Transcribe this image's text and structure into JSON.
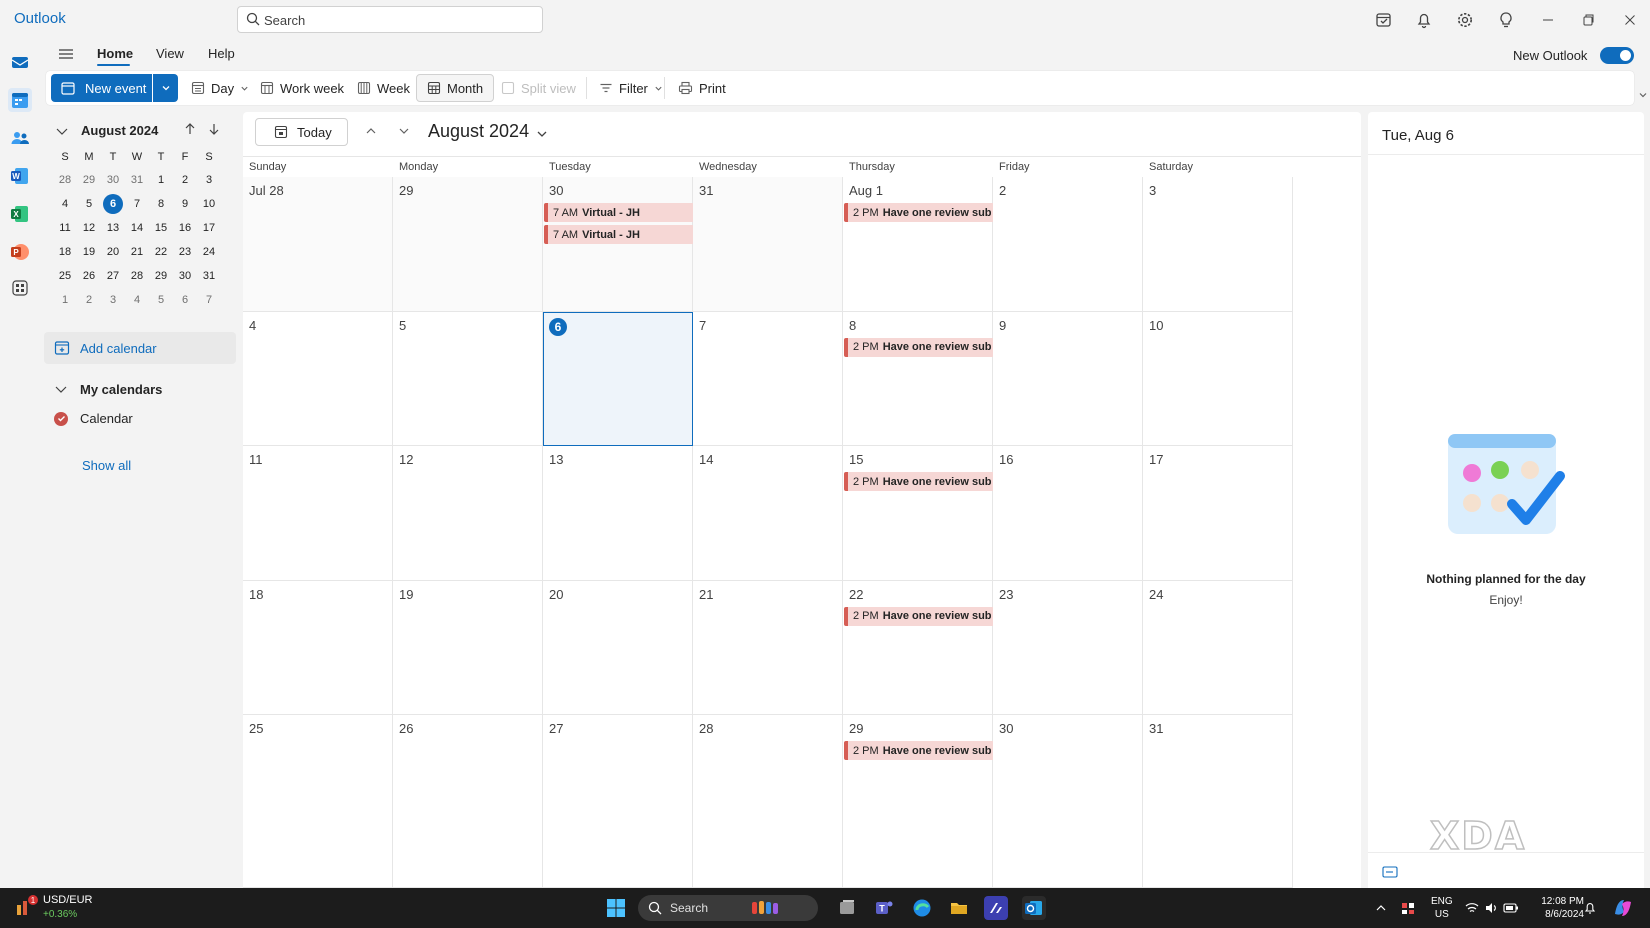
{
  "app": {
    "title": "Outlook"
  },
  "search": {
    "placeholder": "Search"
  },
  "ribbon": {
    "tabs": [
      {
        "label": "Home",
        "active": true
      },
      {
        "label": "View"
      },
      {
        "label": "Help"
      }
    ],
    "new_outlook_label": "New Outlook",
    "new_outlook_enabled": true
  },
  "commands": {
    "new_event": "New event",
    "day": "Day",
    "work_week": "Work week",
    "week": "Week",
    "month": "Month",
    "split_view": "Split view",
    "filter": "Filter",
    "print": "Print"
  },
  "mini_calendar": {
    "title": "August 2024",
    "weekdays": [
      "S",
      "M",
      "T",
      "W",
      "T",
      "F",
      "S"
    ],
    "weeks": [
      [
        "28",
        "29",
        "30",
        "31",
        "1",
        "2",
        "3"
      ],
      [
        "4",
        "5",
        "6",
        "7",
        "8",
        "9",
        "10"
      ],
      [
        "11",
        "12",
        "13",
        "14",
        "15",
        "16",
        "17"
      ],
      [
        "18",
        "19",
        "20",
        "21",
        "22",
        "23",
        "24"
      ],
      [
        "25",
        "26",
        "27",
        "28",
        "29",
        "30",
        "31"
      ],
      [
        "1",
        "2",
        "3",
        "4",
        "5",
        "6",
        "7"
      ]
    ]
  },
  "left_pane": {
    "add_calendar": "Add calendar",
    "my_calendars": "My calendars",
    "calendars": [
      {
        "name": "Calendar",
        "color": "#c8504a"
      }
    ],
    "show_all": "Show all"
  },
  "main": {
    "today_label": "Today",
    "month_title": "August 2024",
    "weekdays": [
      "Sunday",
      "Monday",
      "Tuesday",
      "Wednesday",
      "Thursday",
      "Friday",
      "Saturday"
    ],
    "weeks": [
      [
        {
          "label": "Jul 28",
          "other": true
        },
        {
          "label": "29",
          "other": true
        },
        {
          "label": "30",
          "other": true,
          "events": [
            {
              "time": "7 AM",
              "title": "Virtual - JH"
            },
            {
              "time": "7 AM",
              "title": "Virtual - JH"
            }
          ]
        },
        {
          "label": "31",
          "other": true
        },
        {
          "label": "Aug 1",
          "events": [
            {
              "time": "2 PM",
              "title": "Have one review sub",
              "recurring": true
            }
          ]
        },
        {
          "label": "2"
        },
        {
          "label": "3"
        }
      ],
      [
        {
          "label": "4"
        },
        {
          "label": "5"
        },
        {
          "label": "6",
          "today": true
        },
        {
          "label": "7"
        },
        {
          "label": "8",
          "events": [
            {
              "time": "2 PM",
              "title": "Have one review sub",
              "recurring": true
            }
          ]
        },
        {
          "label": "9"
        },
        {
          "label": "10"
        }
      ],
      [
        {
          "label": "11"
        },
        {
          "label": "12"
        },
        {
          "label": "13"
        },
        {
          "label": "14"
        },
        {
          "label": "15",
          "events": [
            {
              "time": "2 PM",
              "title": "Have one review sub",
              "recurring": true
            }
          ]
        },
        {
          "label": "16"
        },
        {
          "label": "17"
        }
      ],
      [
        {
          "label": "18"
        },
        {
          "label": "19"
        },
        {
          "label": "20"
        },
        {
          "label": "21"
        },
        {
          "label": "22",
          "events": [
            {
              "time": "2 PM",
              "title": "Have one review sub",
              "recurring": true
            }
          ]
        },
        {
          "label": "23"
        },
        {
          "label": "24"
        }
      ],
      [
        {
          "label": "25"
        },
        {
          "label": "26"
        },
        {
          "label": "27"
        },
        {
          "label": "28"
        },
        {
          "label": "29",
          "events": [
            {
              "time": "2 PM",
              "title": "Have one review sub",
              "recurring": true
            }
          ]
        },
        {
          "label": "30"
        },
        {
          "label": "31"
        }
      ]
    ]
  },
  "right_pane": {
    "date": "Tue, Aug 6",
    "empty_title": "Nothing planned for the day",
    "empty_sub": "Enjoy!",
    "watermark": "XDA"
  },
  "taskbar": {
    "ticker_symbol": "USD/EUR",
    "ticker_change": "+0.36%",
    "ticker_badge": "1",
    "search_label": "Search",
    "lang": "ENG",
    "region": "US",
    "time": "12:08 PM",
    "date": "8/6/2024"
  },
  "colors": {
    "accent": "#0f6cbd",
    "event_fill": "#f6d7d5",
    "event_bar": "#d65e55"
  }
}
